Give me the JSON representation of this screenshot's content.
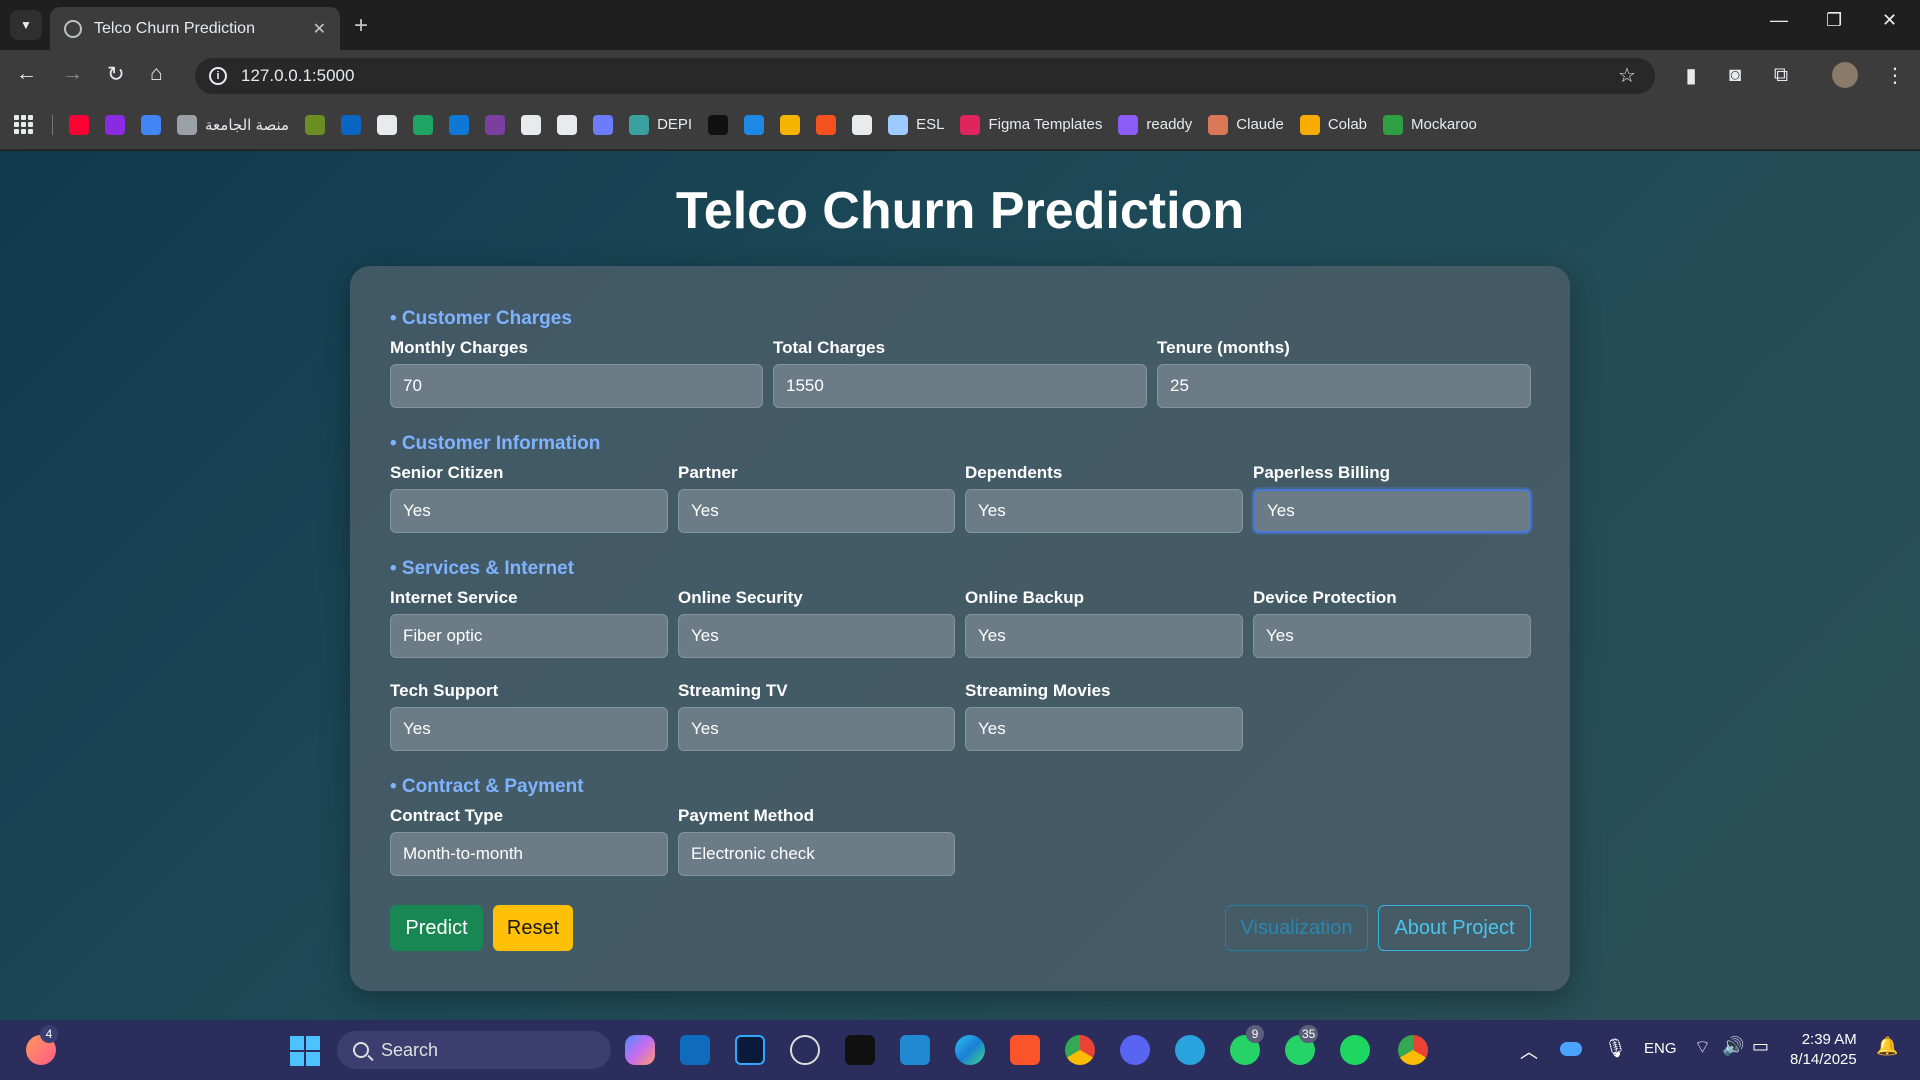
{
  "browser": {
    "tab_title": "Telco Churn Prediction",
    "url": "127.0.0.1:5000",
    "bookmarks": [
      {
        "icon": "youtube-icon",
        "label": "",
        "color": "#ff0033"
      },
      {
        "icon": "purple-app-icon",
        "label": "",
        "color": "#8a2be2"
      },
      {
        "icon": "translate-icon",
        "label": "",
        "color": "#4285f4"
      },
      {
        "icon": "globe-icon",
        "label": "منصة الجامعة",
        "color": "#9aa0a6"
      },
      {
        "icon": "university-icon",
        "label": "",
        "color": "#6b8e23"
      },
      {
        "icon": "linkedin-icon",
        "label": "",
        "color": "#0a66c2"
      },
      {
        "icon": "github-icon",
        "label": "",
        "color": "#e8eaed"
      },
      {
        "icon": "drive-icon",
        "label": "",
        "color": "#1fa463"
      },
      {
        "icon": "onedrive-icon",
        "label": "",
        "color": "#0f78d4"
      },
      {
        "icon": "purple-fruit-icon",
        "label": "",
        "color": "#7b3fa0"
      },
      {
        "icon": "chatgpt-icon",
        "label": "",
        "color": "#e8eaed"
      },
      {
        "icon": "slash-icon",
        "label": "",
        "color": "#e8eaed"
      },
      {
        "icon": "wave-icon",
        "label": "",
        "color": "#6c7cff"
      },
      {
        "icon": "depi-icon",
        "label": "DEPI",
        "color": "#3aa0a0"
      },
      {
        "icon": "upwork-icon",
        "label": "",
        "color": "#111111"
      },
      {
        "icon": "ring-icon",
        "label": "",
        "color": "#1e88e5"
      },
      {
        "icon": "b-icon",
        "label": "",
        "color": "#f4b400"
      },
      {
        "icon": "orange-grid-icon",
        "label": "",
        "color": "#f4511e"
      },
      {
        "icon": "card-icon",
        "label": "",
        "color": "#e8eaed"
      },
      {
        "icon": "esl-icon",
        "label": "ESL",
        "color": "#9ecbff"
      },
      {
        "icon": "figma-icon",
        "label": "Figma Templates",
        "color": "#e0245e"
      },
      {
        "icon": "readdy-icon",
        "label": "readdy",
        "color": "#8b5cf6"
      },
      {
        "icon": "claude-icon",
        "label": "Claude",
        "color": "#d97757"
      },
      {
        "icon": "colab-icon",
        "label": "Colab",
        "color": "#f9ab00"
      },
      {
        "icon": "mockaroo-icon",
        "label": "Mockaroo",
        "color": "#2ea043"
      }
    ]
  },
  "page": {
    "title": "Telco Churn Prediction",
    "sections": {
      "charges": "• Customer Charges",
      "info": "• Customer Information",
      "services": "• Services & Internet",
      "contract": "• Contract & Payment"
    },
    "fields": {
      "monthly_charges": {
        "label": "Monthly Charges",
        "value": "70"
      },
      "total_charges": {
        "label": "Total Charges",
        "value": "1550"
      },
      "tenure": {
        "label": "Tenure (months)",
        "value": "25"
      },
      "senior_citizen": {
        "label": "Senior Citizen",
        "value": "Yes"
      },
      "partner": {
        "label": "Partner",
        "value": "Yes"
      },
      "dependents": {
        "label": "Dependents",
        "value": "Yes"
      },
      "paperless_billing": {
        "label": "Paperless Billing",
        "value": "Yes"
      },
      "internet_service": {
        "label": "Internet Service",
        "value": "Fiber optic"
      },
      "online_security": {
        "label": "Online Security",
        "value": "Yes"
      },
      "online_backup": {
        "label": "Online Backup",
        "value": "Yes"
      },
      "device_protection": {
        "label": "Device Protection",
        "value": "Yes"
      },
      "tech_support": {
        "label": "Tech Support",
        "value": "Yes"
      },
      "streaming_tv": {
        "label": "Streaming TV",
        "value": "Yes"
      },
      "streaming_movies": {
        "label": "Streaming Movies",
        "value": "Yes"
      },
      "contract_type": {
        "label": "Contract Type",
        "value": "Month-to-month"
      },
      "payment_method": {
        "label": "Payment Method",
        "value": "Electronic check"
      }
    },
    "buttons": {
      "predict": "Predict",
      "reset": "Reset",
      "visualization": "Visualization",
      "about": "About Project"
    }
  },
  "taskbar": {
    "search_label": "Search",
    "start_badge": "4",
    "whatsapp_badge": "9",
    "whatsapp2_badge": "35",
    "language": "ENG",
    "time": "2:39 AM",
    "date": "8/14/2025"
  }
}
